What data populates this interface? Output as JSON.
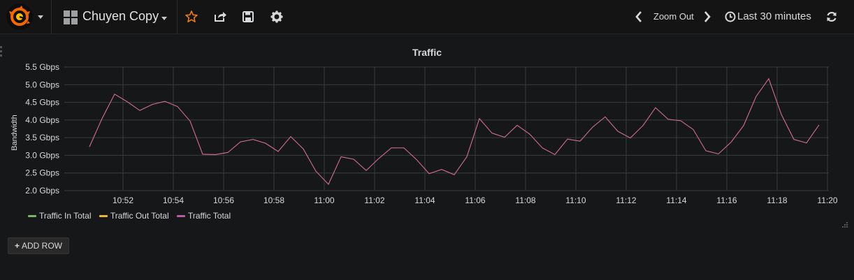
{
  "navbar": {
    "dashboard_title": "Chuyen Copy",
    "zoom_out_label": "Zoom Out",
    "time_range_label": "Last 30 minutes"
  },
  "panel": {
    "title": "Traffic",
    "add_row_label": "ADD ROW"
  },
  "colors": {
    "accent_star": "#eb7b18",
    "logo_orange": "#f46800",
    "series_in": "#7eb26d",
    "series_out": "#eab839",
    "series_total": "#c05aa0"
  },
  "chart_data": {
    "type": "line",
    "title": "Traffic",
    "xlabel": "",
    "ylabel": "Bandwidth",
    "y_unit": "Gbps",
    "ylim": [
      2.0,
      5.5
    ],
    "y_ticks": [
      "2.0 Gbps",
      "2.5 Gbps",
      "3.0 Gbps",
      "3.5 Gbps",
      "4.0 Gbps",
      "4.5 Gbps",
      "5.0 Gbps",
      "5.5 Gbps"
    ],
    "y_tick_values": [
      2.0,
      2.5,
      3.0,
      3.5,
      4.0,
      4.5,
      5.0,
      5.5
    ],
    "x_ticks": [
      "10:52",
      "10:54",
      "10:56",
      "10:58",
      "11:00",
      "11:02",
      "11:04",
      "11:06",
      "11:08",
      "11:10",
      "11:12",
      "11:14",
      "11:16",
      "11:18",
      "11:20"
    ],
    "grid": true,
    "legend_position": "bottom-left",
    "series": [
      {
        "name": "Traffic In Total",
        "color": "#7eb26d",
        "values": []
      },
      {
        "name": "Traffic Out Total",
        "color": "#eab839",
        "values": []
      },
      {
        "name": "Traffic Total",
        "color": "#c05aa0",
        "x": [
          "10:50:40",
          "10:51:10",
          "10:51:40",
          "10:52:10",
          "10:52:40",
          "10:53:10",
          "10:53:40",
          "10:54:10",
          "10:54:40",
          "10:55:10",
          "10:55:40",
          "10:56:10",
          "10:56:40",
          "10:57:10",
          "10:57:40",
          "10:58:10",
          "10:58:40",
          "10:59:10",
          "10:59:40",
          "11:00:10",
          "11:00:40",
          "11:01:10",
          "11:01:40",
          "11:02:10",
          "11:02:40",
          "11:03:10",
          "11:03:40",
          "11:04:10",
          "11:04:40",
          "11:05:10",
          "11:05:40",
          "11:06:10",
          "11:06:40",
          "11:07:10",
          "11:07:40",
          "11:08:10",
          "11:08:40",
          "11:09:10",
          "11:09:40",
          "11:10:10",
          "11:10:40",
          "11:11:10",
          "11:11:40",
          "11:12:10",
          "11:12:40",
          "11:13:10",
          "11:13:40",
          "11:14:10",
          "11:14:40",
          "11:15:10",
          "11:15:40",
          "11:16:10",
          "11:16:40",
          "11:17:10",
          "11:17:40",
          "11:18:10",
          "11:18:40",
          "11:19:10",
          "11:19:40"
        ],
        "values": [
          3.24,
          4.04,
          4.73,
          4.52,
          4.27,
          4.44,
          4.53,
          4.38,
          3.97,
          3.03,
          3.02,
          3.08,
          3.38,
          3.45,
          3.34,
          3.11,
          3.53,
          3.18,
          2.55,
          2.18,
          2.96,
          2.89,
          2.57,
          2.91,
          3.21,
          3.21,
          2.88,
          2.48,
          2.6,
          2.45,
          2.96,
          4.04,
          3.63,
          3.51,
          3.85,
          3.6,
          3.21,
          3.02,
          3.46,
          3.4,
          3.8,
          4.09,
          3.68,
          3.49,
          3.84,
          4.35,
          4.02,
          3.98,
          3.73,
          3.13,
          3.04,
          3.37,
          3.84,
          4.67,
          5.17,
          4.16,
          3.45,
          3.35,
          3.86
        ]
      }
    ]
  }
}
